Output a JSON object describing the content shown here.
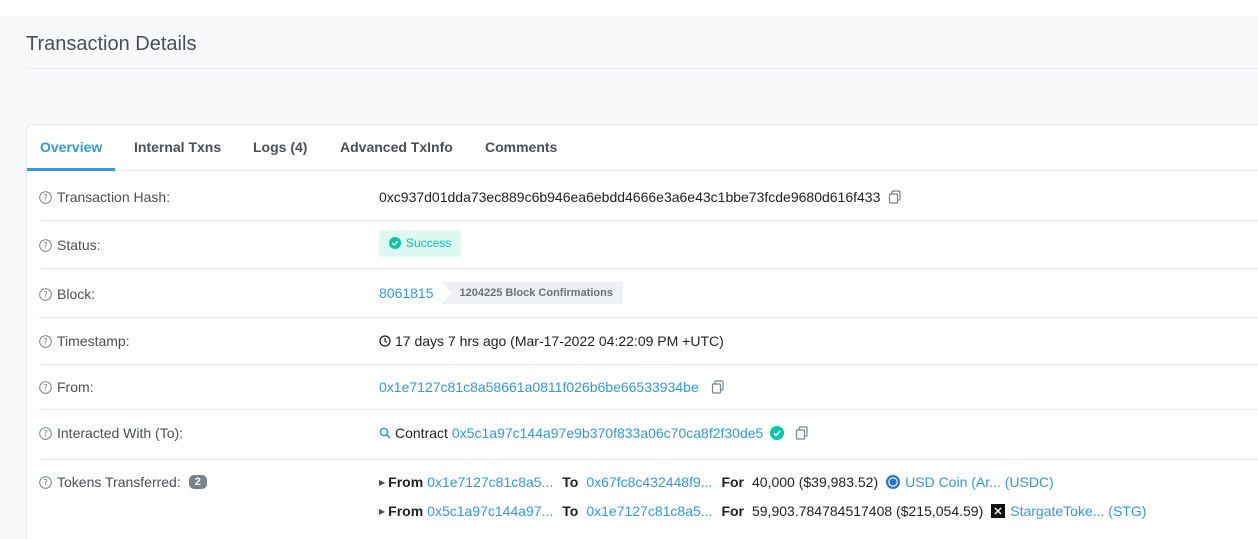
{
  "page": {
    "title": "Transaction Details"
  },
  "tabs": [
    "Overview",
    "Internal Txns",
    "Logs (4)",
    "Advanced TxInfo",
    "Comments"
  ],
  "rows": {
    "hash": {
      "label": "Transaction Hash:",
      "value": "0xc937d01dda73ec889c6b946ea6ebdd4666e3a6e43c1bbe73fcde9680d616f433"
    },
    "status": {
      "label": "Status:",
      "value": "Success"
    },
    "block": {
      "label": "Block:",
      "value": "8061815",
      "confirmations": "1204225 Block Confirmations"
    },
    "timestamp": {
      "label": "Timestamp:",
      "value": "17 days 7 hrs ago (Mar-17-2022 04:22:09 PM +UTC)"
    },
    "from": {
      "label": "From:",
      "value": "0x1e7127c81c8a58661a0811f026b6be66533934be"
    },
    "interacted": {
      "label": "Interacted With (To):",
      "prefix": "Contract",
      "value": "0x5c1a97c144a97e9b370f833a06c70ca8f2f30de5"
    },
    "tokens": {
      "label": "Tokens Transferred:",
      "count": "2",
      "from_word": "From",
      "to_word": "To",
      "for_word": "For",
      "transfers": [
        {
          "from": "0x1e7127c81c8a5...",
          "to": "0x67fc8c432448f9...",
          "amount": "40,000 ($39,983.52)",
          "token": "USD Coin (Ar... (USDC)",
          "icon": "usdc-icon"
        },
        {
          "from": "0x5c1a97c144a97...",
          "to": "0x1e7127c81c8a5...",
          "amount": "59,903.784784517408 ($215,054.59)",
          "token": "StargateToke... (STG)",
          "icon": "stg-icon"
        }
      ]
    }
  },
  "colors": {
    "accent": "#3498db",
    "success": "#00c9a7",
    "success_bg": "#def8f1"
  }
}
